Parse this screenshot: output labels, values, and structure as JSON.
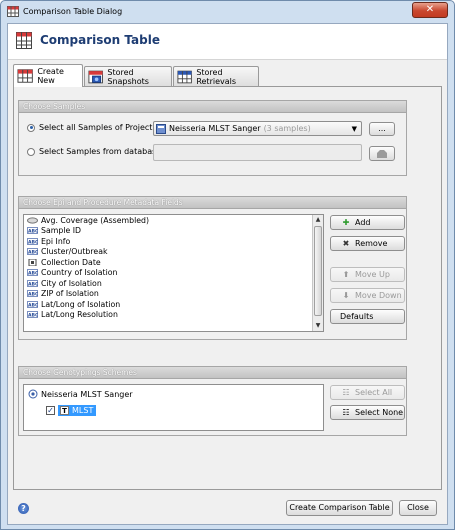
{
  "window": {
    "title": "Comparison Table Dialog",
    "close_glyph": "✕"
  },
  "header": {
    "title": "Comparison Table"
  },
  "tabs": [
    {
      "label": "Create New",
      "active": true,
      "icon": "table-icon"
    },
    {
      "label": "Stored Snapshots",
      "active": false,
      "icon": "camera-table-icon"
    },
    {
      "label": "Stored Retrievals",
      "active": false,
      "icon": "table-icon"
    }
  ],
  "samples": {
    "heading": "Choose Samples",
    "radio_project": "Select all Samples of Project:",
    "radio_database": "Select Samples from database:",
    "project_value": "Neisseria MLST Sanger",
    "project_count": "(3 samples)",
    "browse_label": "...",
    "database_value": ""
  },
  "metadata": {
    "heading": "Choose Epi and Procedure Metadata Fields",
    "items": [
      {
        "label": "Avg. Coverage (Assembled)",
        "icon": "oval-icon"
      },
      {
        "label": "Sample ID",
        "icon": "abc-icon"
      },
      {
        "label": "Epi Info",
        "icon": "abc-icon"
      },
      {
        "label": "Cluster/Outbreak",
        "icon": "abc-icon"
      },
      {
        "label": "Collection Date",
        "icon": "calendar-icon"
      },
      {
        "label": "Country of Isolation",
        "icon": "abc-icon"
      },
      {
        "label": "City of Isolation",
        "icon": "abc-icon"
      },
      {
        "label": "ZIP of Isolation",
        "icon": "abc-icon"
      },
      {
        "label": "Lat/Long of Isolation",
        "icon": "abc-icon"
      },
      {
        "label": "Lat/Long Resolution",
        "icon": "abc-icon"
      }
    ],
    "add_label": "Add",
    "remove_label": "Remove",
    "move_up_label": "Move Up",
    "move_down_label": "Move Down",
    "defaults_label": "Defaults"
  },
  "genotyping": {
    "heading": "Choose Genotypings Schemes",
    "root_label": "Neisseria MLST Sanger",
    "scheme_label": "MLST",
    "select_all_label": "Select All",
    "select_none_label": "Select None"
  },
  "footer": {
    "help_glyph": "?",
    "create_label": "Create Comparison Table",
    "close_label": "Close"
  },
  "colors": {
    "header_title": "#1e3d73",
    "selection": "#3399ff",
    "add_icon": "#2e9b2e"
  }
}
